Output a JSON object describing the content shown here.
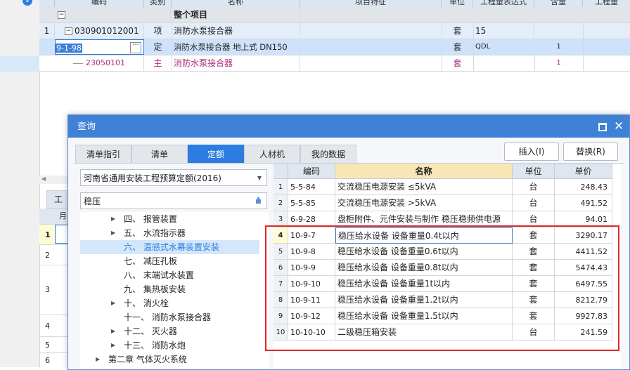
{
  "background": {
    "header_columns": [
      "编码",
      "类别",
      "名称",
      "项目特征",
      "单位",
      "工程量表达式",
      "含量",
      "工程量"
    ],
    "rows": [
      {
        "num": "",
        "code": "",
        "type": "",
        "name": "整个项目",
        "unit": "",
        "expr": "",
        "qty": ""
      },
      {
        "num": "1",
        "code": "030901012001",
        "type": "项",
        "name": "消防水泵接合器",
        "unit": "套",
        "expr": "15",
        "qty": ""
      },
      {
        "num": "",
        "code": "9-1-98",
        "type": "定",
        "name": "消防水泵接合器 地上式 DN150",
        "unit": "套",
        "expr": "QDL",
        "qty": "1"
      },
      {
        "num": "",
        "code": "23050101",
        "type": "主",
        "name": "消防水泵接合器",
        "unit": "套",
        "expr": "",
        "qty": "1"
      }
    ],
    "lower_tab": "工",
    "lower_month_col": "月",
    "lower_rows": [
      "1",
      "2",
      "3",
      "4",
      "5",
      "6"
    ]
  },
  "dialog": {
    "title": "查询",
    "tabs": [
      "清单指引",
      "清单",
      "定额",
      "人材机",
      "我的数据"
    ],
    "active_tab": "定额",
    "insert_button": "插入(I)",
    "replace_button": "替换(R)",
    "quota_library": "河南省通用安装工程预算定额(2016)",
    "search_value": "稳压",
    "tree": [
      {
        "label": "四、 报管装置",
        "indent": 2,
        "arrow": true,
        "selected": false
      },
      {
        "label": "五、 水流指示器",
        "indent": 2,
        "arrow": true,
        "selected": false
      },
      {
        "label": "六、 温感式水幕装置安装",
        "indent": 2,
        "arrow": false,
        "selected": true
      },
      {
        "label": "七、 减压孔板",
        "indent": 2,
        "arrow": false,
        "selected": false
      },
      {
        "label": "八、 末端试水装置",
        "indent": 2,
        "arrow": false,
        "selected": false
      },
      {
        "label": "九、 集热板安装",
        "indent": 2,
        "arrow": false,
        "selected": false
      },
      {
        "label": "十、 消火栓",
        "indent": 2,
        "arrow": true,
        "selected": false
      },
      {
        "label": "十一、 消防水泵接合器",
        "indent": 2,
        "arrow": false,
        "selected": false
      },
      {
        "label": "十二、 灭火器",
        "indent": 2,
        "arrow": true,
        "selected": false
      },
      {
        "label": "十三、 消防水炮",
        "indent": 2,
        "arrow": true,
        "selected": false
      },
      {
        "label": "第二章 气体灭火系统",
        "indent": 1,
        "arrow": true,
        "selected": false
      }
    ],
    "table": {
      "headers": [
        "",
        "编码",
        "名称",
        "单位",
        "单价"
      ],
      "rows": [
        {
          "num": "1",
          "code": "5-5-84",
          "name": "交流稳压电源安装 ≤5kVA",
          "unit": "台",
          "price": "248.43"
        },
        {
          "num": "2",
          "code": "5-5-85",
          "name": "交流稳压电源安装 >5kVA",
          "unit": "台",
          "price": "491.52"
        },
        {
          "num": "3",
          "code": "6-9-28",
          "name": "盘柜附件、元件安装与制作 稳压稳频供电源",
          "unit": "台",
          "price": "94.01"
        },
        {
          "num": "4",
          "code": "10-9-7",
          "name": "稳压给水设备 设备重量0.4t以内",
          "unit": "套",
          "price": "3290.17"
        },
        {
          "num": "5",
          "code": "10-9-8",
          "name": "稳压给水设备 设备重量0.6t以内",
          "unit": "套",
          "price": "4411.52"
        },
        {
          "num": "6",
          "code": "10-9-9",
          "name": "稳压给水设备 设备重量0.8t以内",
          "unit": "套",
          "price": "5474.43"
        },
        {
          "num": "7",
          "code": "10-9-10",
          "name": "稳压给水设备 设备重量1t以内",
          "unit": "套",
          "price": "6497.55"
        },
        {
          "num": "8",
          "code": "10-9-11",
          "name": "稳压给水设备 设备重量1.2t以内",
          "unit": "套",
          "price": "8212.79"
        },
        {
          "num": "9",
          "code": "10-9-12",
          "name": "稳压给水设备 设备重量1.5t以内",
          "unit": "套",
          "price": "9927.83"
        },
        {
          "num": "10",
          "code": "10-10-10",
          "name": "二级稳压箱安装",
          "unit": "台",
          "price": "241.59"
        }
      ]
    }
  }
}
